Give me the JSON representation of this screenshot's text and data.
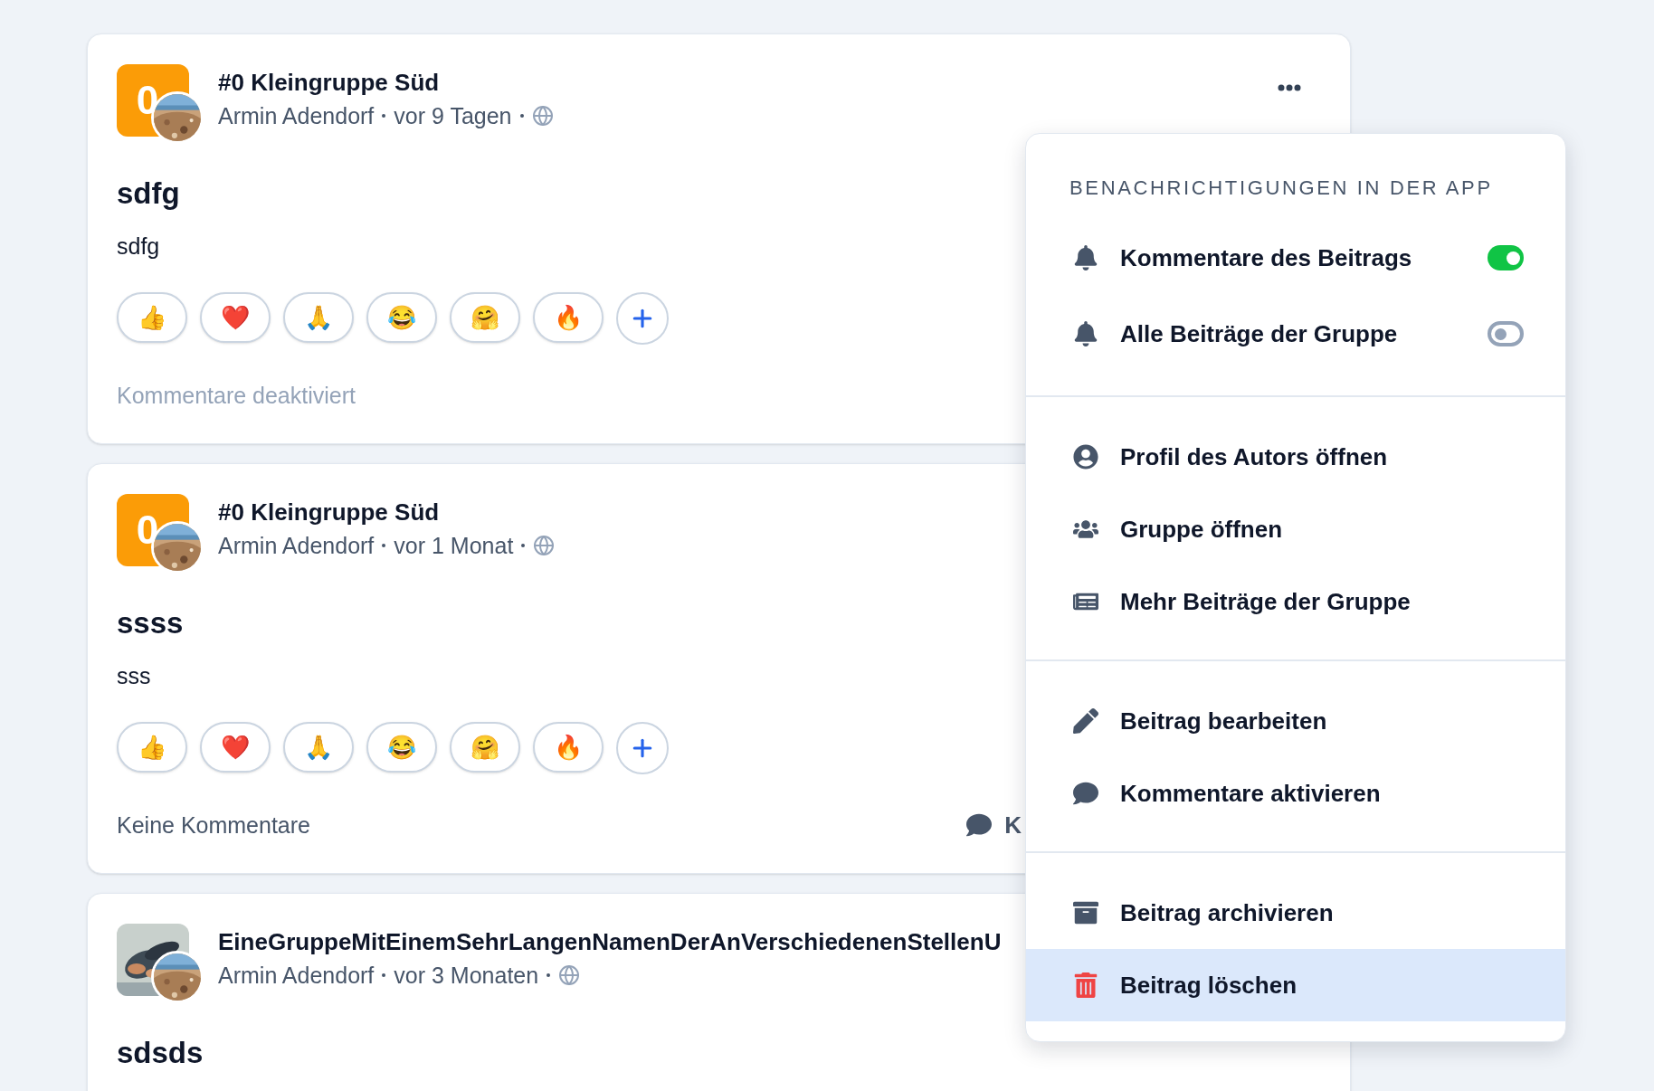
{
  "posts": [
    {
      "group": "#0 Kleingruppe Süd",
      "group_avatar": {
        "kind": "letter",
        "text": "0"
      },
      "author": "Armin Adendorf",
      "time": "vor 9 Tagen",
      "title": "sdfg",
      "body": "sdfg",
      "reactions": [
        "👍",
        "❤️",
        "🙏",
        "😂",
        "🤗",
        "🔥"
      ],
      "footer": {
        "text": "Kommentare deaktiviert",
        "disabled": true
      },
      "more_menu": {
        "kind": "dots"
      }
    },
    {
      "group": "#0 Kleingruppe Süd",
      "group_avatar": {
        "kind": "letter",
        "text": "0"
      },
      "author": "Armin Adendorf",
      "time": "vor 1 Monat",
      "title": "ssss",
      "body": "sss",
      "reactions": [
        "👍",
        "❤️",
        "🙏",
        "😂",
        "🤗",
        "🔥"
      ],
      "footer": {
        "text": "Keine Kommentare",
        "disabled": false,
        "action": "K"
      }
    },
    {
      "group": "EineGruppeMitEinemSehrLangenNamenDerAnVerschiedenenStellenU",
      "author": "Armin Adendorf",
      "time": "vor 3 Monaten",
      "title": "sdsds"
    }
  ],
  "menu": {
    "heading": "BENACHRICHTIGUNGEN IN DER APP",
    "sections": [
      {
        "items": [
          {
            "kind": "toggle",
            "label": "Kommentare des Beitrags",
            "on": true
          },
          {
            "kind": "toggle",
            "label": "Alle Beiträge der Gruppe",
            "on": false
          }
        ]
      },
      {
        "items": [
          {
            "kind": "action",
            "label": "Profil des Autors öffnen",
            "selected": false,
            "danger": false
          },
          {
            "kind": "action",
            "label": "Gruppe öffnen",
            "selected": false,
            "danger": false
          },
          {
            "kind": "action",
            "label": "Mehr Beiträge der Gruppe",
            "selected": false,
            "danger": false
          }
        ]
      },
      {
        "items": [
          {
            "kind": "action",
            "label": "Beitrag bearbeiten",
            "selected": false,
            "danger": false
          },
          {
            "kind": "action",
            "label": "Kommentare aktivieren",
            "selected": false,
            "danger": false
          }
        ]
      },
      {
        "items": [
          {
            "kind": "action",
            "label": "Beitrag archivieren",
            "selected": false,
            "danger": false
          },
          {
            "kind": "action",
            "label": "Beitrag löschen",
            "selected": true,
            "danger": true
          }
        ]
      }
    ]
  }
}
